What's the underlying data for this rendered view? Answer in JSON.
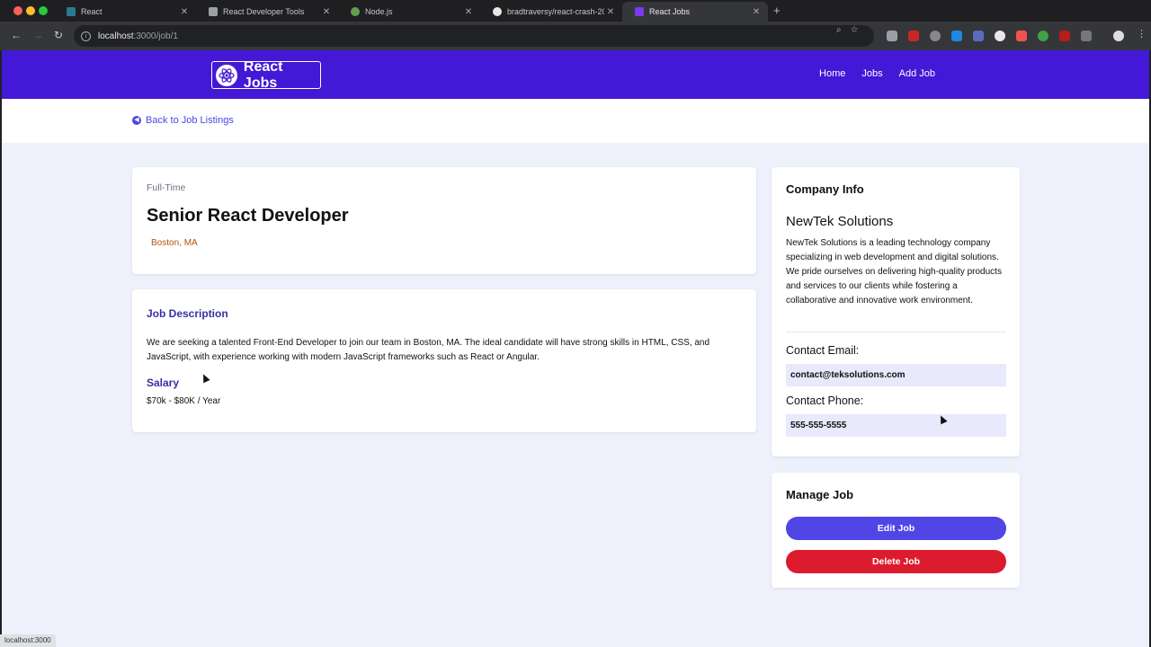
{
  "browser": {
    "tabs": [
      {
        "label": "React",
        "active": false
      },
      {
        "label": "React Developer Tools",
        "active": false
      },
      {
        "label": "Node.js",
        "active": false
      },
      {
        "label": "bradtraversy/react-crash-20",
        "active": false
      },
      {
        "label": "React Jobs",
        "active": true
      }
    ],
    "url_host": "localhost",
    "url_path": ":3000/job/1",
    "status_url": "localhost:3000"
  },
  "nav": {
    "logo_text": "React Jobs",
    "links": [
      "Home",
      "Jobs",
      "Add Job"
    ]
  },
  "back_link": "Back to Job Listings",
  "job": {
    "type": "Full-Time",
    "title": "Senior React Developer",
    "location": "Boston, MA",
    "description_heading": "Job Description",
    "description": "We are seeking a talented Front-End Developer to join our team in Boston, MA. The ideal candidate will have strong skills in HTML, CSS, and JavaScript, with experience working with modern JavaScript frameworks such as React or Angular.",
    "salary_heading": "Salary",
    "salary": "$70k - $80K / Year"
  },
  "company": {
    "heading": "Company Info",
    "name": "NewTek Solutions",
    "description": "NewTek Solutions is a leading technology company specializing in web development and digital solutions. We pride ourselves on delivering high-quality products and services to our clients while fostering a collaborative and innovative work environment.",
    "email_label": "Contact Email:",
    "email": "contact@teksolutions.com",
    "phone_label": "Contact Phone:",
    "phone": "555-555-5555"
  },
  "manage": {
    "heading": "Manage Job",
    "edit_label": "Edit Job",
    "delete_label": "Delete Job"
  },
  "colors": {
    "navbar": "#4318d6",
    "accent": "#4f46e5",
    "danger": "#dc1c2e",
    "page_bg": "#eef0fb"
  }
}
